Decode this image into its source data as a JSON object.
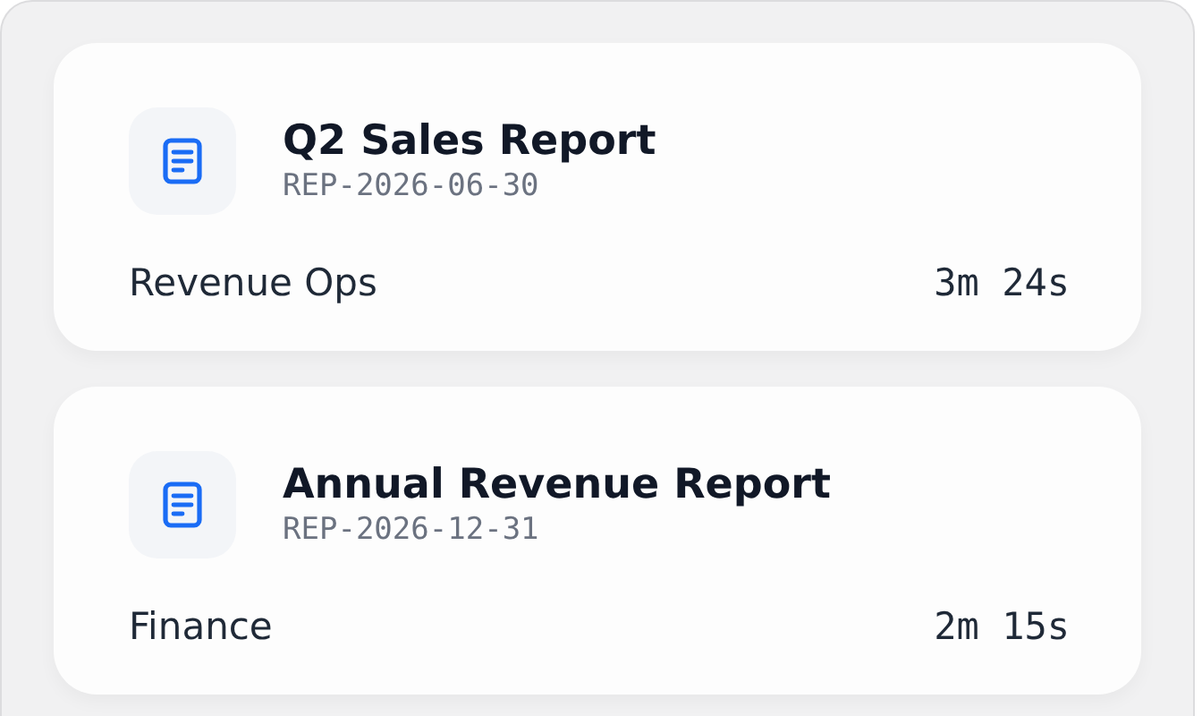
{
  "reports": [
    {
      "title": "Q2 Sales Report",
      "code": "REP-2026-06-30",
      "team": "Revenue Ops",
      "duration": "3m 24s"
    },
    {
      "title": "Annual Revenue Report",
      "code": "REP-2026-12-31",
      "team": "Finance",
      "duration": "2m 15s"
    }
  ]
}
